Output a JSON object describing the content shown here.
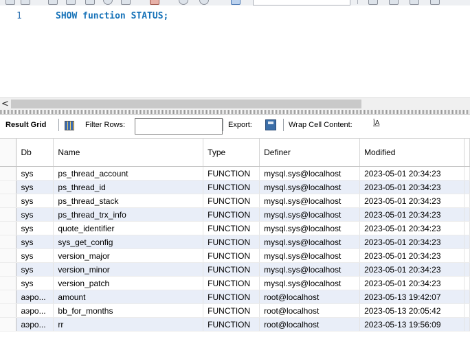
{
  "editor": {
    "lines": [
      {
        "number": "1",
        "code": "SHOW function STATUS;"
      }
    ]
  },
  "scrollbar": {
    "left_arrow": "<"
  },
  "result_toolbar": {
    "result_grid_label": "Result Grid",
    "filter_rows_label": "Filter Rows:",
    "filter_rows_value": "",
    "export_label": "Export:",
    "wrap_label": "Wrap Cell Content:",
    "wrap_icon": "ĪA"
  },
  "columns": [
    "Db",
    "Name",
    "Type",
    "Definer",
    "Modified"
  ],
  "rows": [
    [
      "sys",
      "ps_thread_account",
      "FUNCTION",
      "mysql.sys@localhost",
      "2023-05-01 20:34:23"
    ],
    [
      "sys",
      "ps_thread_id",
      "FUNCTION",
      "mysql.sys@localhost",
      "2023-05-01 20:34:23"
    ],
    [
      "sys",
      "ps_thread_stack",
      "FUNCTION",
      "mysql.sys@localhost",
      "2023-05-01 20:34:23"
    ],
    [
      "sys",
      "ps_thread_trx_info",
      "FUNCTION",
      "mysql.sys@localhost",
      "2023-05-01 20:34:23"
    ],
    [
      "sys",
      "quote_identifier",
      "FUNCTION",
      "mysql.sys@localhost",
      "2023-05-01 20:34:23"
    ],
    [
      "sys",
      "sys_get_config",
      "FUNCTION",
      "mysql.sys@localhost",
      "2023-05-01 20:34:23"
    ],
    [
      "sys",
      "version_major",
      "FUNCTION",
      "mysql.sys@localhost",
      "2023-05-01 20:34:23"
    ],
    [
      "sys",
      "version_minor",
      "FUNCTION",
      "mysql.sys@localhost",
      "2023-05-01 20:34:23"
    ],
    [
      "sys",
      "version_patch",
      "FUNCTION",
      "mysql.sys@localhost",
      "2023-05-01 20:34:23"
    ],
    [
      "аэро...",
      "amount",
      "FUNCTION",
      "root@localhost",
      "2023-05-13 19:42:07"
    ],
    [
      "аэро...",
      "bb_for_months",
      "FUNCTION",
      "root@localhost",
      "2023-05-13 20:05:42"
    ],
    [
      "аэро...",
      "rr",
      "FUNCTION",
      "root@localhost",
      "2023-05-13 19:56:09"
    ]
  ],
  "colors": {
    "keyword": "#1672b8",
    "line_number": "#2a6fb0",
    "alt_row": "#e9eef8"
  }
}
